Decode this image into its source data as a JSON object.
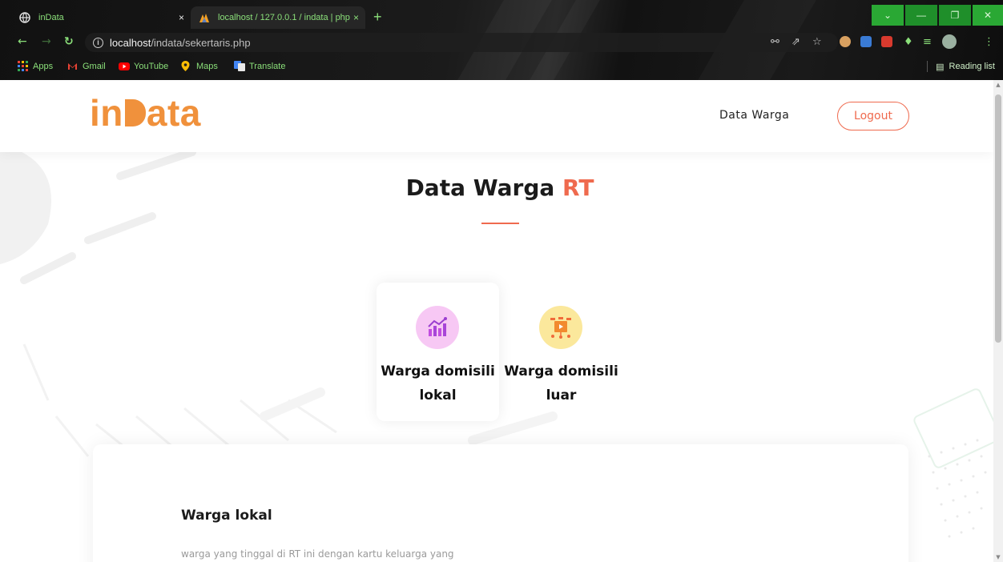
{
  "browser": {
    "tabs": [
      {
        "title": "inData",
        "active": false
      },
      {
        "title": "localhost / 127.0.0.1 / indata | php",
        "active": true
      }
    ],
    "new_tab": "+",
    "close_glyph": "×",
    "url_host": "localhost",
    "url_path": "/indata/sekertaris.php",
    "bookmarks": [
      "Apps",
      "Gmail",
      "YouTube",
      "Maps",
      "Translate"
    ],
    "reading_list": "Reading list",
    "colors": {
      "accent_green": "#8be07a",
      "window_controls": "#2aa834"
    }
  },
  "site": {
    "logo": {
      "prefix": "in",
      "suffix": "ata"
    },
    "nav": {
      "data_warga": "Data Warga",
      "logout": "Logout"
    },
    "colors": {
      "brand_orange": "#f0913c",
      "accent_red": "#ef6a4e"
    }
  },
  "main": {
    "title": "Data Warga",
    "title_accent": "RT",
    "cards": [
      {
        "label": "Warga domisili lokal",
        "icon": "chart-icon"
      },
      {
        "label": "Warga domisili luar",
        "icon": "presentation-icon"
      }
    ],
    "panel": {
      "title": "Warga lokal",
      "description": "warga yang tinggal di RT ini dengan kartu keluarga yang"
    }
  }
}
